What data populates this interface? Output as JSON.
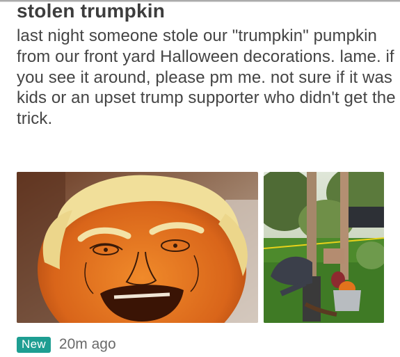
{
  "post": {
    "title": "stolen trumpkin",
    "body": "last night someone stole our \"trumpkin\" pumpkin from our front yard Halloween decorations. lame.  if you see it around, please pm me. not sure if it was kids or an upset trump supporter who didn't get the trick."
  },
  "photos": [
    {
      "icon": "pumpkin-photo"
    },
    {
      "icon": "yard-decoration-photo"
    }
  ],
  "meta": {
    "badge": "New",
    "timestamp": "20m ago",
    "badge_color": "#1e9e92"
  }
}
